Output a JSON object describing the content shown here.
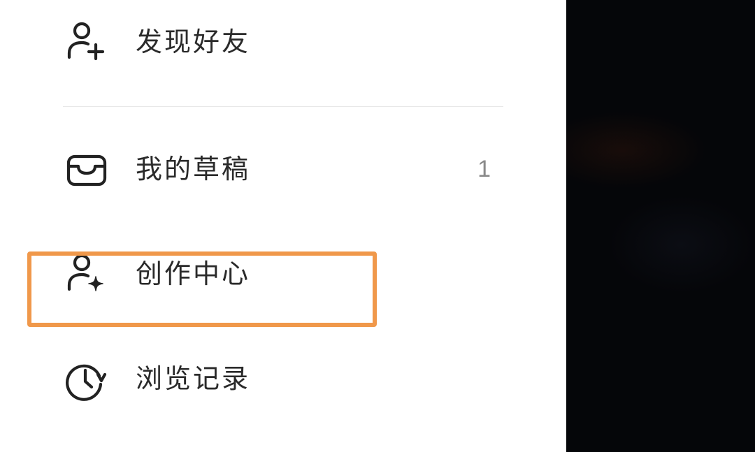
{
  "menu": {
    "items": [
      {
        "label": "发现好友",
        "icon": "add-friend-icon"
      },
      {
        "label": "我的草稿",
        "icon": "inbox-tray-icon",
        "count": "1"
      },
      {
        "label": "创作中心",
        "icon": "creator-user-sparkle-icon"
      },
      {
        "label": "浏览记录",
        "icon": "history-clock-icon"
      }
    ]
  },
  "colors": {
    "drawer_background": "#ffffff",
    "backdrop": "#050609",
    "text": "#2a2a2a",
    "count_text": "#8a8a8a",
    "highlight_border": "#f0984a",
    "divider": "#e8e8e8"
  }
}
